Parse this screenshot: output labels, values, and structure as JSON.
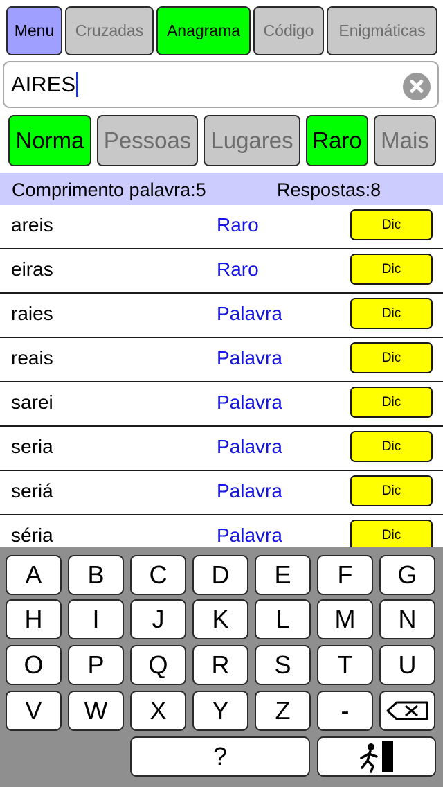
{
  "top_tabs": {
    "menu": "Menu",
    "cruzadas": "Cruzadas",
    "anagrama": "Anagrama",
    "codigo": "Código",
    "enigmaticas": "Enigmáticas"
  },
  "search": {
    "value": "AIRES",
    "clear_icon": "clear-circle-x-icon"
  },
  "filters": {
    "norma": "Norma",
    "pessoas": "Pessoas",
    "lugares": "Lugares",
    "raro": "Raro",
    "mais": "Mais"
  },
  "info": {
    "length": "Comprimento palavra:5",
    "answers": "Respostas:8"
  },
  "results": [
    {
      "word": "areis",
      "type": "Raro",
      "dic": "Dic"
    },
    {
      "word": "eiras",
      "type": "Raro",
      "dic": "Dic"
    },
    {
      "word": "raies",
      "type": "Palavra",
      "dic": "Dic"
    },
    {
      "word": "reais",
      "type": "Palavra",
      "dic": "Dic"
    },
    {
      "word": "sarei",
      "type": "Palavra",
      "dic": "Dic"
    },
    {
      "word": "seria",
      "type": "Palavra",
      "dic": "Dic"
    },
    {
      "word": "seriá",
      "type": "Palavra",
      "dic": "Dic"
    },
    {
      "word": "séria",
      "type": "Palavra",
      "dic": "Dic"
    }
  ],
  "keyboard": {
    "row1": [
      "A",
      "B",
      "C",
      "D",
      "E",
      "F",
      "G"
    ],
    "row2": [
      "H",
      "I",
      "J",
      "K",
      "L",
      "M",
      "N"
    ],
    "row3": [
      "O",
      "P",
      "Q",
      "R",
      "S",
      "T",
      "U"
    ],
    "row4": [
      "V",
      "W",
      "X",
      "Y",
      "Z",
      "-"
    ],
    "backspace_icon": "backspace-icon",
    "question": "?",
    "exit_icon": "exit-running-man-icon"
  },
  "colors": {
    "active_green": "#00ff00",
    "inactive_gray": "#c8c8c8",
    "menu_purple": "#9f9fff",
    "info_bar": "#ccccff",
    "dic_yellow": "#ffff00",
    "type_blue": "#1414e6"
  }
}
